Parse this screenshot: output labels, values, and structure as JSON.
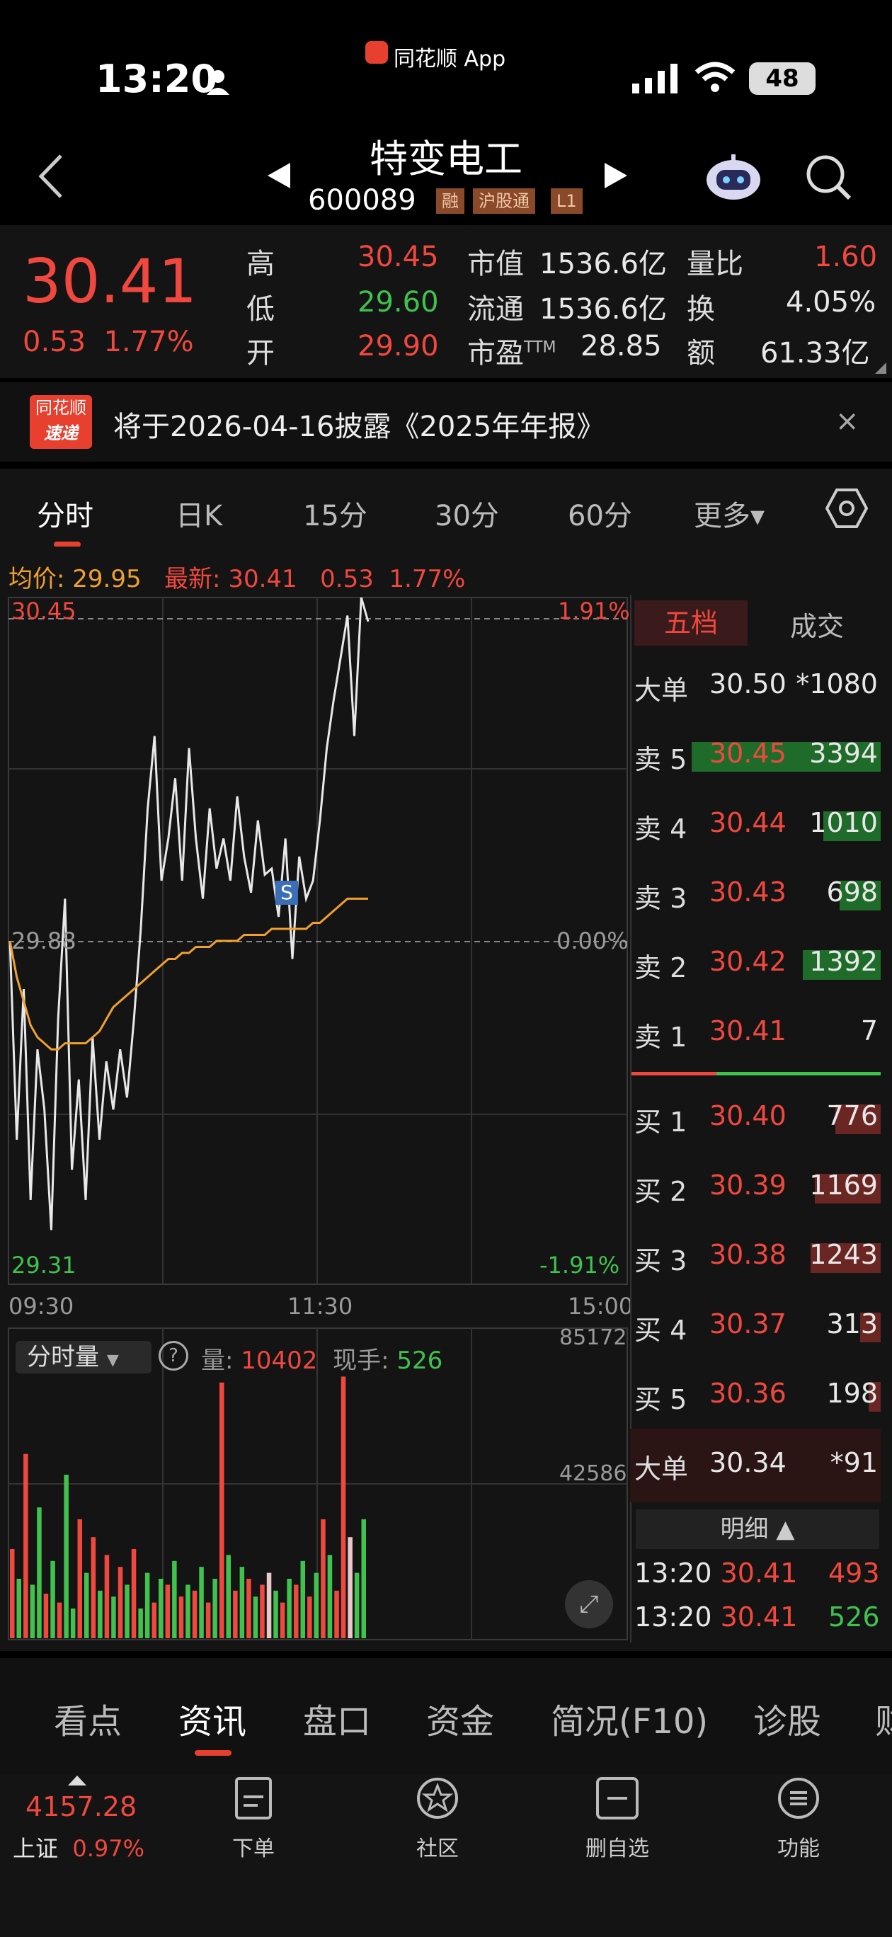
{
  "status": {
    "time": "13:20",
    "app": "同花顺 App",
    "battery": "48"
  },
  "nav": {
    "title": "特变电工",
    "code": "600089",
    "tags": [
      "融",
      "沪股通",
      "L1"
    ]
  },
  "quote": {
    "price": "30.41",
    "change": "0.53",
    "change_pct": "1.77%",
    "fields": [
      {
        "label": "高",
        "value": "30.45",
        "color": "red"
      },
      {
        "label": "低",
        "value": "29.60",
        "color": "green"
      },
      {
        "label": "开",
        "value": "29.90",
        "color": "red"
      },
      {
        "label": "市值",
        "value": "1536.6亿",
        "color": "white"
      },
      {
        "label": "流通",
        "value": "1536.6亿",
        "color": "white"
      },
      {
        "label": "市盈",
        "sup": "TTM",
        "value": "28.85",
        "color": "white"
      },
      {
        "label": "量比",
        "value": "1.60",
        "color": "red"
      },
      {
        "label": "换",
        "value": "4.05%",
        "color": "white"
      },
      {
        "label": "额",
        "value": "61.33亿",
        "color": "white"
      }
    ]
  },
  "notice": {
    "logo_top": "同花顺",
    "logo_bottom": "速递",
    "text": "将于2026-04-16披露《2025年年报》",
    "close": "×"
  },
  "tabs": [
    "分时",
    "日K",
    "15分",
    "30分",
    "60分",
    "更多▾"
  ],
  "chart_info": {
    "avg_label": "均价:",
    "avg_value": "29.95",
    "latest_label": "最新:",
    "latest_value": "30.41",
    "chg": "0.53",
    "chg_pct": "1.77%"
  },
  "chart_data": {
    "type": "line",
    "price_axis": {
      "max": "30.45",
      "mid": "29.88",
      "min": "29.31",
      "max_pct": "1.91%",
      "mid_pct": "0.00%",
      "min_pct": "-1.91%"
    },
    "time_labels": [
      "09:30",
      "11:30",
      "15:00"
    ],
    "marker": "S",
    "ylim": [
      29.31,
      30.45
    ],
    "price": [
      29.88,
      29.55,
      29.8,
      29.45,
      29.7,
      29.6,
      29.4,
      29.75,
      29.95,
      29.5,
      29.65,
      29.45,
      29.72,
      29.55,
      29.68,
      29.6,
      29.7,
      29.62,
      29.75,
      29.9,
      30.1,
      30.22,
      29.98,
      30.05,
      30.15,
      29.98,
      30.2,
      30.05,
      29.95,
      30.1,
      30.0,
      30.05,
      29.98,
      30.12,
      30.02,
      29.96,
      30.08,
      29.99,
      30.0,
      29.92,
      30.05,
      29.85,
      30.02,
      29.95,
      29.98,
      30.08,
      30.2,
      30.28,
      30.35,
      30.42,
      30.22,
      30.45,
      30.41
    ],
    "avg": [
      29.88,
      29.82,
      29.78,
      29.74,
      29.72,
      29.71,
      29.7,
      29.7,
      29.71,
      29.71,
      29.71,
      29.71,
      29.72,
      29.73,
      29.75,
      29.77,
      29.78,
      29.79,
      29.8,
      29.81,
      29.82,
      29.83,
      29.84,
      29.85,
      29.85,
      29.86,
      29.86,
      29.87,
      29.87,
      29.87,
      29.88,
      29.88,
      29.88,
      29.88,
      29.89,
      29.89,
      29.89,
      29.89,
      29.9,
      29.9,
      29.9,
      29.9,
      29.9,
      29.9,
      29.91,
      29.91,
      29.92,
      29.93,
      29.94,
      29.95,
      29.95,
      29.95,
      29.95
    ],
    "volume_axis": {
      "max": "85172",
      "mid": "42586"
    },
    "volume_label": "分时量",
    "vol_label": "量:",
    "vol_value": "10402",
    "hand_label": "现手:",
    "hand_value": "526",
    "volumes": [
      30,
      20,
      62,
      18,
      44,
      15,
      26,
      12,
      55,
      10,
      40,
      22,
      34,
      16,
      28,
      14,
      24,
      18,
      30,
      10,
      22,
      12,
      20,
      18,
      26,
      14,
      18,
      16,
      24,
      12,
      20,
      86,
      28,
      16,
      24,
      20,
      14,
      18,
      22,
      16,
      12,
      20,
      18,
      26,
      14,
      22,
      40,
      28,
      16,
      88,
      34,
      22,
      40
    ],
    "volume_colors": [
      "r",
      "g",
      "r",
      "g",
      "g",
      "r",
      "g",
      "r",
      "g",
      "g",
      "r",
      "g",
      "r",
      "g",
      "r",
      "g",
      "r",
      "g",
      "r",
      "g",
      "g",
      "r",
      "g",
      "r",
      "g",
      "r",
      "g",
      "r",
      "g",
      "r",
      "g",
      "r",
      "g",
      "r",
      "g",
      "r",
      "g",
      "r",
      "w",
      "g",
      "r",
      "g",
      "r",
      "g",
      "r",
      "g",
      "r",
      "g",
      "r",
      "r",
      "w",
      "g",
      "g"
    ]
  },
  "orderbook": {
    "tabs": [
      "五档",
      "成交"
    ],
    "big_sell": {
      "label": "大单",
      "price": "30.50",
      "vol": "*1080"
    },
    "sells": [
      {
        "label": "卖 5",
        "price": "30.45",
        "vol": "3394",
        "bar": 0.46
      },
      {
        "label": "卖 4",
        "price": "30.44",
        "vol": "1010",
        "bar": 0.14
      },
      {
        "label": "卖 3",
        "price": "30.43",
        "vol": "698",
        "bar": 0.1
      },
      {
        "label": "卖 2",
        "price": "30.42",
        "vol": "1392",
        "bar": 0.19
      },
      {
        "label": "卖 1",
        "price": "30.41",
        "vol": "7",
        "bar": 0.0
      }
    ],
    "buys": [
      {
        "label": "买 1",
        "price": "30.40",
        "vol": "776",
        "bar": 0.11
      },
      {
        "label": "买 2",
        "price": "30.39",
        "vol": "1169",
        "bar": 0.16
      },
      {
        "label": "买 3",
        "price": "30.38",
        "vol": "1243",
        "bar": 0.17
      },
      {
        "label": "买 4",
        "price": "30.37",
        "vol": "313",
        "bar": 0.05
      },
      {
        "label": "买 5",
        "price": "30.36",
        "vol": "198",
        "bar": 0.03
      }
    ],
    "big_buy": {
      "label": "大单",
      "price": "30.34",
      "vol": "*91"
    },
    "detail_label": "明细 ▲",
    "ticks": [
      {
        "time": "13:20",
        "price": "30.41",
        "vol": "493",
        "color": "red"
      },
      {
        "time": "13:20",
        "price": "30.41",
        "vol": "526",
        "color": "green"
      }
    ]
  },
  "bottom_tabs": [
    "看点",
    "资讯",
    "盘口",
    "资金",
    "简况(F10)",
    "诊股",
    "财"
  ],
  "index": {
    "value": "4157.28",
    "name": "上证",
    "pct": "0.97%"
  },
  "toolbar": [
    {
      "label": "下单",
      "icon": "document-icon"
    },
    {
      "label": "社区",
      "icon": "star-badge-icon"
    },
    {
      "label": "删自选",
      "icon": "minus-box-icon"
    },
    {
      "label": "功能",
      "icon": "menu-circle-icon"
    }
  ]
}
